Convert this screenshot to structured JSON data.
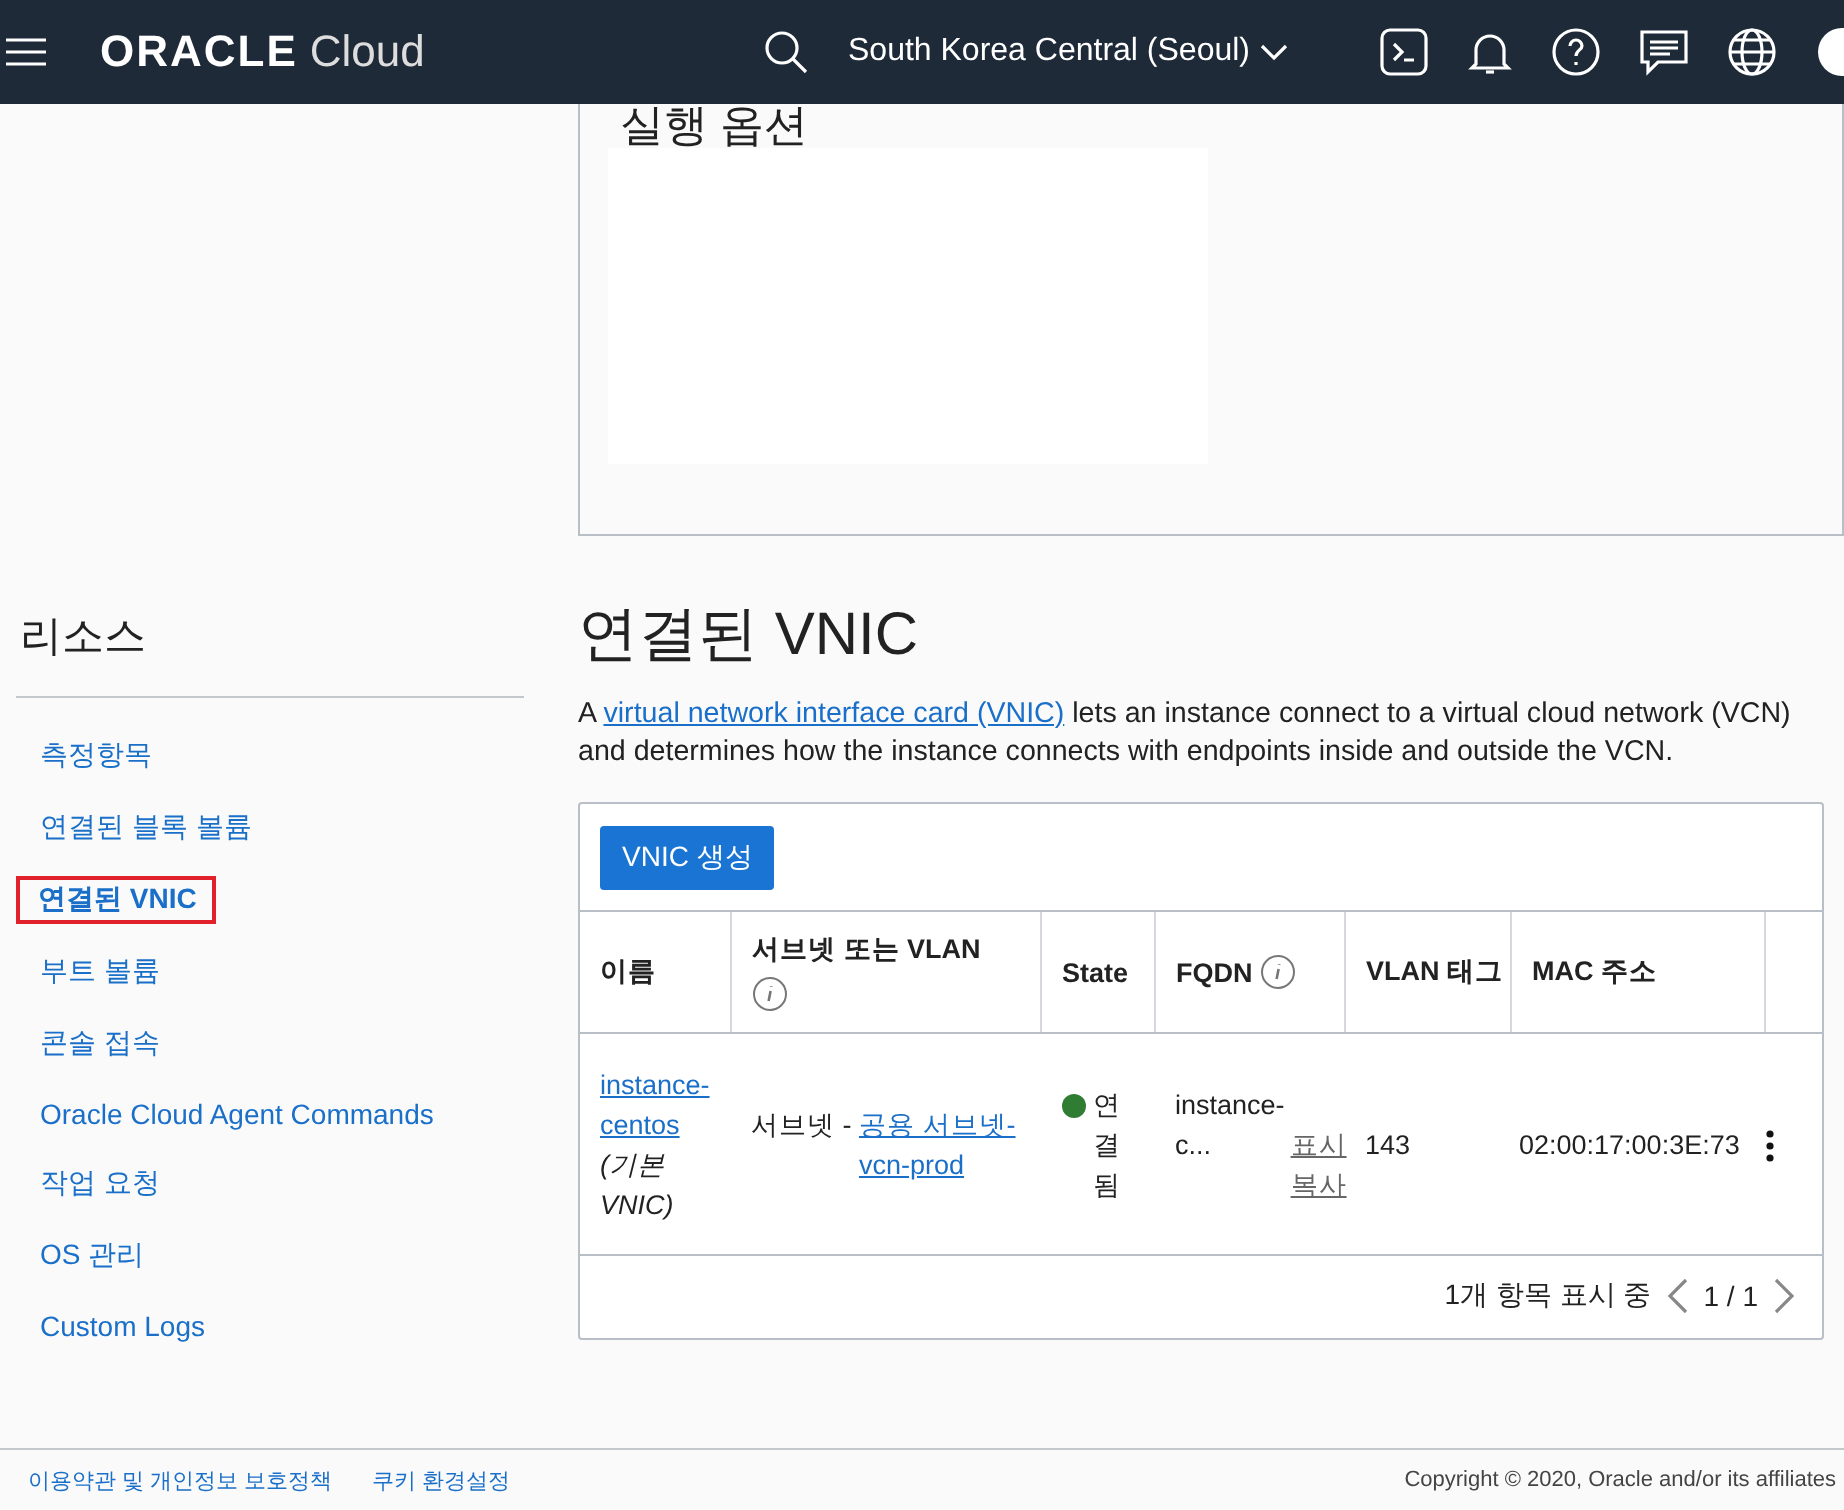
{
  "header": {
    "logo": "ORACLE",
    "product": "Cloud",
    "region": "South Korea Central (Seoul)"
  },
  "top_panel": {
    "title": "실행 옵션"
  },
  "sidebar": {
    "title": "리소스",
    "items": [
      {
        "label": "측정항목",
        "selected": false
      },
      {
        "label": "연결된 블록 볼륨",
        "selected": false
      },
      {
        "label": "연결된 VNIC",
        "selected": true
      },
      {
        "label": "부트 볼륨",
        "selected": false
      },
      {
        "label": "콘솔 접속",
        "selected": false
      },
      {
        "label": "Oracle Cloud Agent Commands",
        "selected": false
      },
      {
        "label": "작업 요청",
        "selected": false
      },
      {
        "label": "OS 관리",
        "selected": false
      },
      {
        "label": "Custom Logs",
        "selected": false
      }
    ]
  },
  "section": {
    "title": "연결된 VNIC",
    "intro_before": "A ",
    "intro_link": "virtual network interface card (VNIC)",
    "intro_after": " lets an instance connect to a virtual cloud network (VCN) and determines how the instance connects with endpoints inside and outside the VCN.",
    "create_button": "VNIC 생성"
  },
  "table": {
    "columns": [
      {
        "label": "이름",
        "info": false
      },
      {
        "label": "서브넷 또는 VLAN",
        "info": true
      },
      {
        "label": "State",
        "info": false
      },
      {
        "label": "FQDN",
        "info": true
      },
      {
        "label": "VLAN 태그",
        "info": false
      },
      {
        "label": "MAC 주소",
        "info": false
      }
    ],
    "rows": [
      {
        "name": "instance-centos",
        "note": "(기본 VNIC)",
        "subnet_prefix": "서브넷 - ",
        "subnet_link": "공용 서브넷-vcn-prod",
        "state": "연결됨",
        "color": "#2e7d32",
        "fqdn": "instance-c...",
        "fqdn_show": "표시",
        "fqdn_copy": "복사",
        "vlan_tag": "143",
        "mac": "02:00:17:00:3E:73"
      }
    ],
    "footer": "1개 항목 표시 중",
    "page": "1 / 1"
  },
  "footer": {
    "links": [
      "이용약관 및 개인정보 보호정책",
      "쿠키 환경설정"
    ],
    "copyright": "Copyright © 2020, Oracle and/or its affiliates"
  }
}
